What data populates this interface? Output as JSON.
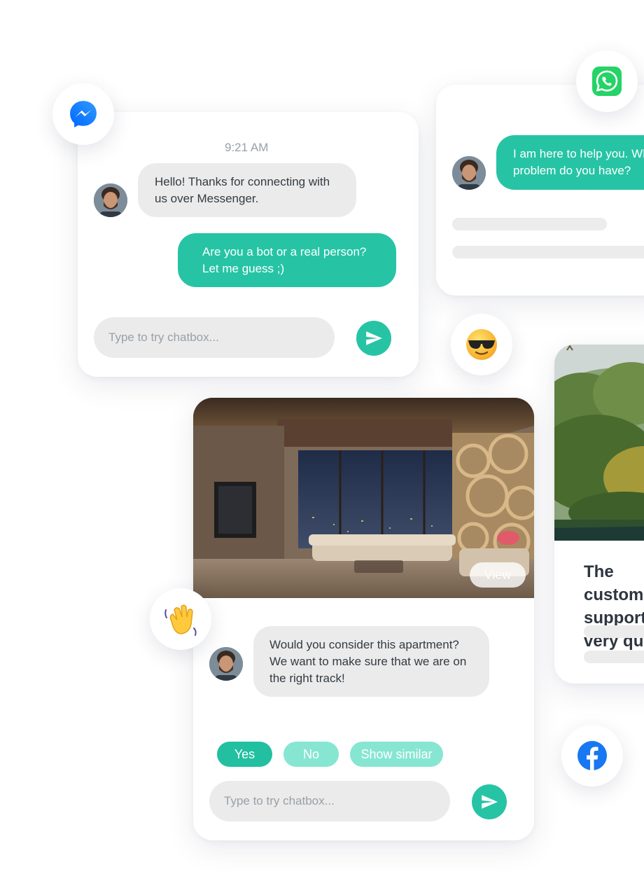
{
  "messenger_chat": {
    "timestamp": "9:21 AM",
    "incoming": "Hello! Thanks for connecting with us over Messenger.",
    "outgoing": "Are you a bot or a real person? Let me guess ;)",
    "input_placeholder": "Type to try chatbox..."
  },
  "whatsapp_chat": {
    "outgoing": "I am here to help you. What problem do you have?"
  },
  "apartment_chat": {
    "view_label": "View",
    "incoming": "Would you consider this apartment? We want to make sure that we are on the right track!",
    "quick_replies": [
      "Yes",
      "No",
      "Show similar"
    ],
    "input_placeholder": "Type to try chatbox..."
  },
  "review_card": {
    "text": "The customer support was very quick"
  },
  "icons": {
    "messenger": "messenger-icon",
    "whatsapp": "whatsapp-icon",
    "sunglasses": "sunglasses-emoji-icon",
    "wave": "waving-hand-emoji-icon",
    "facebook": "facebook-icon",
    "send": "send-icon"
  },
  "colors": {
    "accent": "#26c4a5",
    "accent_light": "#86e6d2",
    "bubble_incoming": "#ebebeb",
    "messenger_blue": "#0a7cff",
    "whatsapp_green": "#25d366",
    "facebook_blue": "#1877f2"
  }
}
